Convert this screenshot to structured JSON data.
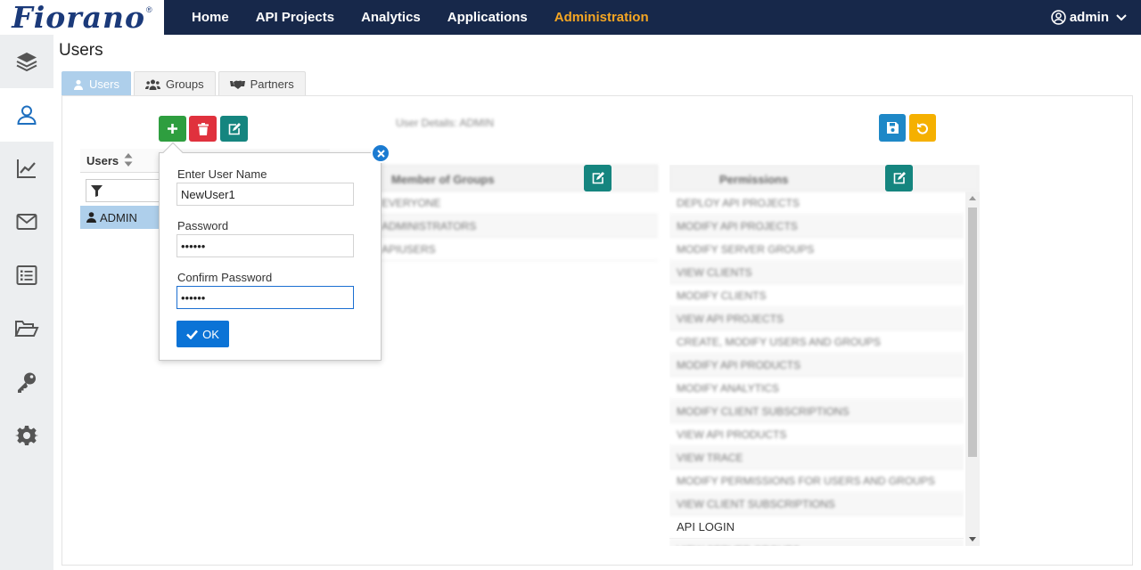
{
  "brand": {
    "logo_text": "Fiorano",
    "logo_mark": "®"
  },
  "topnav": {
    "items": [
      "Home",
      "API Projects",
      "Analytics",
      "Applications",
      "Administration"
    ],
    "active_index": 4,
    "user": "admin"
  },
  "sidenav": {
    "icons": [
      "layers-icon",
      "user-icon",
      "chart-icon",
      "mail-icon",
      "list-icon",
      "folder-icon",
      "key-icon",
      "gear-icon"
    ],
    "active_index": 1
  },
  "page": {
    "title": "Users",
    "tabs": [
      {
        "label": "Users",
        "active": true
      },
      {
        "label": "Groups",
        "active": false
      },
      {
        "label": "Partners",
        "active": false
      }
    ]
  },
  "users_panel": {
    "header": "Users",
    "rows": [
      "ADMIN"
    ]
  },
  "details": {
    "title": "User Details: ADMIN",
    "groups_header": "Member of Groups",
    "groups": [
      "EVERYONE",
      "ADMINISTRATORS",
      "APIUSERS"
    ],
    "permissions_header": "Permissions",
    "permissions": [
      "DEPLOY API PROJECTS",
      "MODIFY API PROJECTS",
      "MODIFY SERVER GROUPS",
      "VIEW CLIENTS",
      "MODIFY CLIENTS",
      "VIEW API PROJECTS",
      "CREATE, MODIFY USERS AND GROUPS",
      "MODIFY API PRODUCTS",
      "MODIFY ANALYTICS",
      "MODIFY CLIENT SUBSCRIPTIONS",
      "VIEW API PRODUCTS",
      "VIEW TRACE",
      "MODIFY PERMISSIONS FOR USERS AND GROUPS",
      "VIEW CLIENT SUBSCRIPTIONS",
      "API LOGIN",
      "VIEW SERVER GROUPS"
    ]
  },
  "popover": {
    "username_label": "Enter User Name",
    "username_value": "NewUser1",
    "password_label": "Password",
    "password_value": "••••••",
    "confirm_label": "Confirm Password",
    "confirm_value": "••••••",
    "ok_label": "OK"
  },
  "colors": {
    "topbar": "#17284a",
    "active_nav": "#f5a623",
    "add": "#2e9e3f",
    "delete": "#e0313d",
    "edit": "#15857f",
    "ok": "#0b73d6"
  }
}
